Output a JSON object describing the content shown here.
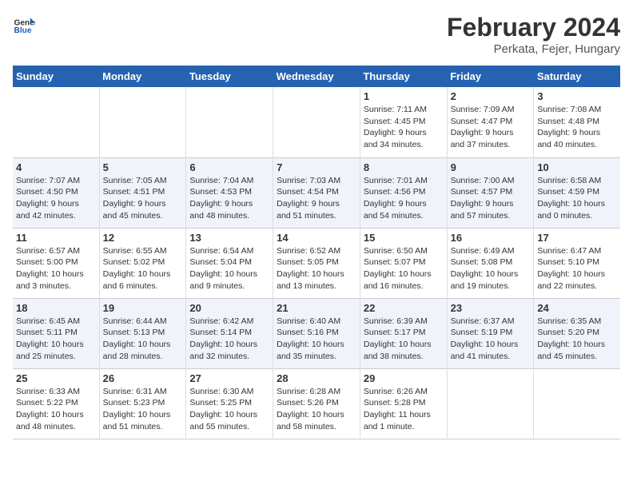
{
  "logo": {
    "text_general": "General",
    "text_blue": "Blue"
  },
  "header": {
    "title": "February 2024",
    "subtitle": "Perkata, Fejer, Hungary"
  },
  "calendar": {
    "days_of_week": [
      "Sunday",
      "Monday",
      "Tuesday",
      "Wednesday",
      "Thursday",
      "Friday",
      "Saturday"
    ],
    "weeks": [
      [
        {
          "day": "",
          "info": ""
        },
        {
          "day": "",
          "info": ""
        },
        {
          "day": "",
          "info": ""
        },
        {
          "day": "",
          "info": ""
        },
        {
          "day": "1",
          "info": "Sunrise: 7:11 AM\nSunset: 4:45 PM\nDaylight: 9 hours\nand 34 minutes."
        },
        {
          "day": "2",
          "info": "Sunrise: 7:09 AM\nSunset: 4:47 PM\nDaylight: 9 hours\nand 37 minutes."
        },
        {
          "day": "3",
          "info": "Sunrise: 7:08 AM\nSunset: 4:48 PM\nDaylight: 9 hours\nand 40 minutes."
        }
      ],
      [
        {
          "day": "4",
          "info": "Sunrise: 7:07 AM\nSunset: 4:50 PM\nDaylight: 9 hours\nand 42 minutes."
        },
        {
          "day": "5",
          "info": "Sunrise: 7:05 AM\nSunset: 4:51 PM\nDaylight: 9 hours\nand 45 minutes."
        },
        {
          "day": "6",
          "info": "Sunrise: 7:04 AM\nSunset: 4:53 PM\nDaylight: 9 hours\nand 48 minutes."
        },
        {
          "day": "7",
          "info": "Sunrise: 7:03 AM\nSunset: 4:54 PM\nDaylight: 9 hours\nand 51 minutes."
        },
        {
          "day": "8",
          "info": "Sunrise: 7:01 AM\nSunset: 4:56 PM\nDaylight: 9 hours\nand 54 minutes."
        },
        {
          "day": "9",
          "info": "Sunrise: 7:00 AM\nSunset: 4:57 PM\nDaylight: 9 hours\nand 57 minutes."
        },
        {
          "day": "10",
          "info": "Sunrise: 6:58 AM\nSunset: 4:59 PM\nDaylight: 10 hours\nand 0 minutes."
        }
      ],
      [
        {
          "day": "11",
          "info": "Sunrise: 6:57 AM\nSunset: 5:00 PM\nDaylight: 10 hours\nand 3 minutes."
        },
        {
          "day": "12",
          "info": "Sunrise: 6:55 AM\nSunset: 5:02 PM\nDaylight: 10 hours\nand 6 minutes."
        },
        {
          "day": "13",
          "info": "Sunrise: 6:54 AM\nSunset: 5:04 PM\nDaylight: 10 hours\nand 9 minutes."
        },
        {
          "day": "14",
          "info": "Sunrise: 6:52 AM\nSunset: 5:05 PM\nDaylight: 10 hours\nand 13 minutes."
        },
        {
          "day": "15",
          "info": "Sunrise: 6:50 AM\nSunset: 5:07 PM\nDaylight: 10 hours\nand 16 minutes."
        },
        {
          "day": "16",
          "info": "Sunrise: 6:49 AM\nSunset: 5:08 PM\nDaylight: 10 hours\nand 19 minutes."
        },
        {
          "day": "17",
          "info": "Sunrise: 6:47 AM\nSunset: 5:10 PM\nDaylight: 10 hours\nand 22 minutes."
        }
      ],
      [
        {
          "day": "18",
          "info": "Sunrise: 6:45 AM\nSunset: 5:11 PM\nDaylight: 10 hours\nand 25 minutes."
        },
        {
          "day": "19",
          "info": "Sunrise: 6:44 AM\nSunset: 5:13 PM\nDaylight: 10 hours\nand 28 minutes."
        },
        {
          "day": "20",
          "info": "Sunrise: 6:42 AM\nSunset: 5:14 PM\nDaylight: 10 hours\nand 32 minutes."
        },
        {
          "day": "21",
          "info": "Sunrise: 6:40 AM\nSunset: 5:16 PM\nDaylight: 10 hours\nand 35 minutes."
        },
        {
          "day": "22",
          "info": "Sunrise: 6:39 AM\nSunset: 5:17 PM\nDaylight: 10 hours\nand 38 minutes."
        },
        {
          "day": "23",
          "info": "Sunrise: 6:37 AM\nSunset: 5:19 PM\nDaylight: 10 hours\nand 41 minutes."
        },
        {
          "day": "24",
          "info": "Sunrise: 6:35 AM\nSunset: 5:20 PM\nDaylight: 10 hours\nand 45 minutes."
        }
      ],
      [
        {
          "day": "25",
          "info": "Sunrise: 6:33 AM\nSunset: 5:22 PM\nDaylight: 10 hours\nand 48 minutes."
        },
        {
          "day": "26",
          "info": "Sunrise: 6:31 AM\nSunset: 5:23 PM\nDaylight: 10 hours\nand 51 minutes."
        },
        {
          "day": "27",
          "info": "Sunrise: 6:30 AM\nSunset: 5:25 PM\nDaylight: 10 hours\nand 55 minutes."
        },
        {
          "day": "28",
          "info": "Sunrise: 6:28 AM\nSunset: 5:26 PM\nDaylight: 10 hours\nand 58 minutes."
        },
        {
          "day": "29",
          "info": "Sunrise: 6:26 AM\nSunset: 5:28 PM\nDaylight: 11 hours\nand 1 minute."
        },
        {
          "day": "",
          "info": ""
        },
        {
          "day": "",
          "info": ""
        }
      ]
    ]
  }
}
